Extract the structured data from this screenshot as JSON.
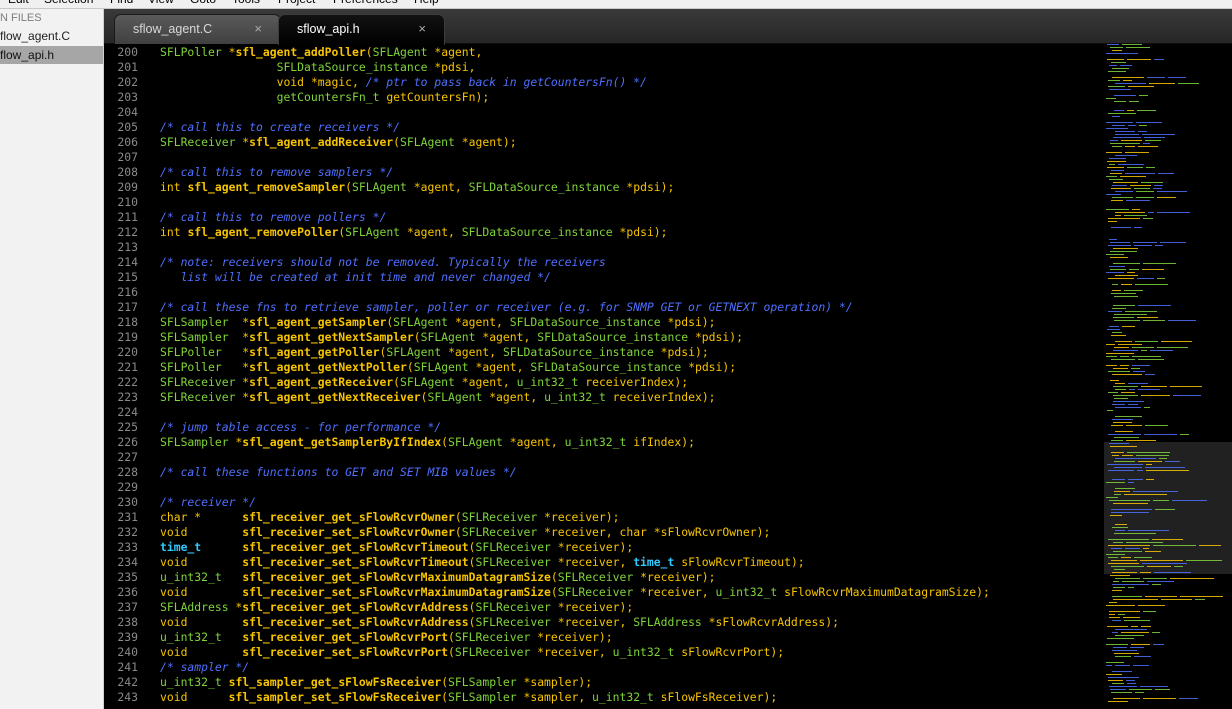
{
  "menu": {
    "items": [
      "Edit",
      "Selection",
      "Find",
      "View",
      "Goto",
      "Tools",
      "Project",
      "Preferences",
      "Help"
    ]
  },
  "sidebar": {
    "header": "N FILES",
    "files": [
      {
        "label": "flow_agent.C",
        "active": false
      },
      {
        "label": "flow_api.h",
        "active": true
      }
    ]
  },
  "tabs": [
    {
      "label": "sflow_agent.C",
      "active": false
    },
    {
      "label": "sflow_api.h",
      "active": true
    }
  ],
  "tab_close_glyph": "×",
  "colors": {
    "background": "#000000",
    "type": "#7fd43a",
    "function": "#f7c400",
    "text": "#f7c400",
    "comment": "#4f6fff",
    "builtin_type": "#33c9ff",
    "line_number": "#8a8a8a"
  },
  "editor": {
    "lines": [
      {
        "n": "200",
        "t": [
          [
            "ty",
            "SFLPoller"
          ],
          [
            "tx",
            " *"
          ],
          [
            "fn",
            "sfl_agent_addPoller"
          ],
          [
            "tx",
            "("
          ],
          [
            "ty",
            "SFLAgent"
          ],
          [
            "tx",
            " *agent,"
          ]
        ]
      },
      {
        "n": "201",
        "t": [
          [
            "tx",
            "                 "
          ],
          [
            "ty",
            "SFLDataSource_instance"
          ],
          [
            "tx",
            " *pdsi,"
          ]
        ]
      },
      {
        "n": "202",
        "t": [
          [
            "tx",
            "                 void *magic, "
          ],
          [
            "cm",
            "/* ptr to pass back in getCountersFn() */"
          ]
        ]
      },
      {
        "n": "203",
        "t": [
          [
            "tx",
            "                 "
          ],
          [
            "ty",
            "getCountersFn_t"
          ],
          [
            "tx",
            " getCountersFn);"
          ]
        ]
      },
      {
        "n": "204",
        "t": []
      },
      {
        "n": "205",
        "t": [
          [
            "cm",
            "/* call this to create receivers */"
          ]
        ]
      },
      {
        "n": "206",
        "t": [
          [
            "ty",
            "SFLReceiver"
          ],
          [
            "tx",
            " *"
          ],
          [
            "fn",
            "sfl_agent_addReceiver"
          ],
          [
            "tx",
            "("
          ],
          [
            "ty",
            "SFLAgent"
          ],
          [
            "tx",
            " *agent);"
          ]
        ]
      },
      {
        "n": "207",
        "t": []
      },
      {
        "n": "208",
        "t": [
          [
            "cm",
            "/* call this to remove samplers */"
          ]
        ]
      },
      {
        "n": "209",
        "t": [
          [
            "tx",
            "int "
          ],
          [
            "fn",
            "sfl_agent_removeSampler"
          ],
          [
            "tx",
            "("
          ],
          [
            "ty",
            "SFLAgent"
          ],
          [
            "tx",
            " *agent, "
          ],
          [
            "ty",
            "SFLDataSource_instance"
          ],
          [
            "tx",
            " *pdsi);"
          ]
        ]
      },
      {
        "n": "210",
        "t": []
      },
      {
        "n": "211",
        "t": [
          [
            "cm",
            "/* call this to remove pollers */"
          ]
        ]
      },
      {
        "n": "212",
        "t": [
          [
            "tx",
            "int "
          ],
          [
            "fn",
            "sfl_agent_removePoller"
          ],
          [
            "tx",
            "("
          ],
          [
            "ty",
            "SFLAgent"
          ],
          [
            "tx",
            " *agent, "
          ],
          [
            "ty",
            "SFLDataSource_instance"
          ],
          [
            "tx",
            " *pdsi);"
          ]
        ]
      },
      {
        "n": "213",
        "t": []
      },
      {
        "n": "214",
        "t": [
          [
            "cm",
            "/* note: receivers should not be removed. Typically the receivers"
          ]
        ]
      },
      {
        "n": "215",
        "t": [
          [
            "cm",
            "   list will be created at init time and never changed */"
          ]
        ]
      },
      {
        "n": "216",
        "t": []
      },
      {
        "n": "217",
        "t": [
          [
            "cm",
            "/* call these fns to retrieve sampler, poller or receiver (e.g. for SNMP GET or GETNEXT operation) */"
          ]
        ]
      },
      {
        "n": "218",
        "t": [
          [
            "ty",
            "SFLSampler"
          ],
          [
            "tx",
            "  *"
          ],
          [
            "fn",
            "sfl_agent_getSampler"
          ],
          [
            "tx",
            "("
          ],
          [
            "ty",
            "SFLAgent"
          ],
          [
            "tx",
            " *agent, "
          ],
          [
            "ty",
            "SFLDataSource_instance"
          ],
          [
            "tx",
            " *pdsi);"
          ]
        ]
      },
      {
        "n": "219",
        "t": [
          [
            "ty",
            "SFLSampler"
          ],
          [
            "tx",
            "  *"
          ],
          [
            "fn",
            "sfl_agent_getNextSampler"
          ],
          [
            "tx",
            "("
          ],
          [
            "ty",
            "SFLAgent"
          ],
          [
            "tx",
            " *agent, "
          ],
          [
            "ty",
            "SFLDataSource_instance"
          ],
          [
            "tx",
            " *pdsi);"
          ]
        ]
      },
      {
        "n": "220",
        "t": [
          [
            "ty",
            "SFLPoller"
          ],
          [
            "tx",
            "   *"
          ],
          [
            "fn",
            "sfl_agent_getPoller"
          ],
          [
            "tx",
            "("
          ],
          [
            "ty",
            "SFLAgent"
          ],
          [
            "tx",
            " *agent, "
          ],
          [
            "ty",
            "SFLDataSource_instance"
          ],
          [
            "tx",
            " *pdsi);"
          ]
        ]
      },
      {
        "n": "221",
        "t": [
          [
            "ty",
            "SFLPoller"
          ],
          [
            "tx",
            "   *"
          ],
          [
            "fn",
            "sfl_agent_getNextPoller"
          ],
          [
            "tx",
            "("
          ],
          [
            "ty",
            "SFLAgent"
          ],
          [
            "tx",
            " *agent, "
          ],
          [
            "ty",
            "SFLDataSource_instance"
          ],
          [
            "tx",
            " *pdsi);"
          ]
        ]
      },
      {
        "n": "222",
        "t": [
          [
            "ty",
            "SFLReceiver"
          ],
          [
            "tx",
            " *"
          ],
          [
            "fn",
            "sfl_agent_getReceiver"
          ],
          [
            "tx",
            "("
          ],
          [
            "ty",
            "SFLAgent"
          ],
          [
            "tx",
            " *agent, "
          ],
          [
            "ty",
            "u_int32_t"
          ],
          [
            "tx",
            " receiverIndex);"
          ]
        ]
      },
      {
        "n": "223",
        "t": [
          [
            "ty",
            "SFLReceiver"
          ],
          [
            "tx",
            " *"
          ],
          [
            "fn",
            "sfl_agent_getNextReceiver"
          ],
          [
            "tx",
            "("
          ],
          [
            "ty",
            "SFLAgent"
          ],
          [
            "tx",
            " *agent, "
          ],
          [
            "ty",
            "u_int32_t"
          ],
          [
            "tx",
            " receiverIndex);"
          ]
        ]
      },
      {
        "n": "224",
        "t": []
      },
      {
        "n": "225",
        "t": [
          [
            "cm",
            "/* jump table access - for performance */"
          ]
        ]
      },
      {
        "n": "226",
        "t": [
          [
            "ty",
            "SFLSampler"
          ],
          [
            "tx",
            " *"
          ],
          [
            "fn",
            "sfl_agent_getSamplerByIfIndex"
          ],
          [
            "tx",
            "("
          ],
          [
            "ty",
            "SFLAgent"
          ],
          [
            "tx",
            " *agent, "
          ],
          [
            "ty",
            "u_int32_t"
          ],
          [
            "tx",
            " ifIndex);"
          ]
        ]
      },
      {
        "n": "227",
        "t": []
      },
      {
        "n": "228",
        "t": [
          [
            "cm",
            "/* call these functions to GET and SET MIB values */"
          ]
        ]
      },
      {
        "n": "229",
        "t": []
      },
      {
        "n": "230",
        "t": [
          [
            "cm",
            "/* receiver */"
          ]
        ]
      },
      {
        "n": "231",
        "t": [
          [
            "tx",
            "char *      "
          ],
          [
            "fn",
            "sfl_receiver_get_sFlowRcvrOwner"
          ],
          [
            "tx",
            "("
          ],
          [
            "ty",
            "SFLReceiver"
          ],
          [
            "tx",
            " *receiver);"
          ]
        ]
      },
      {
        "n": "232",
        "t": [
          [
            "tx",
            "void        "
          ],
          [
            "fn",
            "sfl_receiver_set_sFlowRcvrOwner"
          ],
          [
            "tx",
            "("
          ],
          [
            "ty",
            "SFLReceiver"
          ],
          [
            "tx",
            " *receiver, char *sFlowRcvrOwner);"
          ]
        ]
      },
      {
        "n": "233",
        "t": [
          [
            "tb",
            "time_t"
          ],
          [
            "tx",
            "      "
          ],
          [
            "fn",
            "sfl_receiver_get_sFlowRcvrTimeout"
          ],
          [
            "tx",
            "("
          ],
          [
            "ty",
            "SFLReceiver"
          ],
          [
            "tx",
            " *receiver);"
          ]
        ]
      },
      {
        "n": "234",
        "t": [
          [
            "tx",
            "void        "
          ],
          [
            "fn",
            "sfl_receiver_set_sFlowRcvrTimeout"
          ],
          [
            "tx",
            "("
          ],
          [
            "ty",
            "SFLReceiver"
          ],
          [
            "tx",
            " *receiver, "
          ],
          [
            "tb",
            "time_t"
          ],
          [
            "tx",
            " sFlowRcvrTimeout);"
          ]
        ]
      },
      {
        "n": "235",
        "t": [
          [
            "ty",
            "u_int32_t"
          ],
          [
            "tx",
            "   "
          ],
          [
            "fn",
            "sfl_receiver_get_sFlowRcvrMaximumDatagramSize"
          ],
          [
            "tx",
            "("
          ],
          [
            "ty",
            "SFLReceiver"
          ],
          [
            "tx",
            " *receiver);"
          ]
        ]
      },
      {
        "n": "236",
        "t": [
          [
            "tx",
            "void        "
          ],
          [
            "fn",
            "sfl_receiver_set_sFlowRcvrMaximumDatagramSize"
          ],
          [
            "tx",
            "("
          ],
          [
            "ty",
            "SFLReceiver"
          ],
          [
            "tx",
            " *receiver, "
          ],
          [
            "ty",
            "u_int32_t"
          ],
          [
            "tx",
            " sFlowRcvrMaximumDatagramSize);"
          ]
        ]
      },
      {
        "n": "237",
        "t": [
          [
            "ty",
            "SFLAddress"
          ],
          [
            "tx",
            " *"
          ],
          [
            "fn",
            "sfl_receiver_get_sFlowRcvrAddress"
          ],
          [
            "tx",
            "("
          ],
          [
            "ty",
            "SFLReceiver"
          ],
          [
            "tx",
            " *receiver);"
          ]
        ]
      },
      {
        "n": "238",
        "t": [
          [
            "tx",
            "void        "
          ],
          [
            "fn",
            "sfl_receiver_set_sFlowRcvrAddress"
          ],
          [
            "tx",
            "("
          ],
          [
            "ty",
            "SFLReceiver"
          ],
          [
            "tx",
            " *receiver, "
          ],
          [
            "ty",
            "SFLAddress"
          ],
          [
            "tx",
            " *sFlowRcvrAddress);"
          ]
        ]
      },
      {
        "n": "239",
        "t": [
          [
            "ty",
            "u_int32_t"
          ],
          [
            "tx",
            "   "
          ],
          [
            "fn",
            "sfl_receiver_get_sFlowRcvrPort"
          ],
          [
            "tx",
            "("
          ],
          [
            "ty",
            "SFLReceiver"
          ],
          [
            "tx",
            " *receiver);"
          ]
        ]
      },
      {
        "n": "240",
        "t": [
          [
            "tx",
            "void        "
          ],
          [
            "fn",
            "sfl_receiver_set_sFlowRcvrPort"
          ],
          [
            "tx",
            "("
          ],
          [
            "ty",
            "SFLReceiver"
          ],
          [
            "tx",
            " *receiver, "
          ],
          [
            "ty",
            "u_int32_t"
          ],
          [
            "tx",
            " sFlowRcvrPort);"
          ]
        ]
      },
      {
        "n": "241",
        "t": [
          [
            "cm",
            "/* sampler */"
          ]
        ]
      },
      {
        "n": "242",
        "t": [
          [
            "ty",
            "u_int32_t"
          ],
          [
            "tx",
            " "
          ],
          [
            "fn",
            "sfl_sampler_get_sFlowFsReceiver"
          ],
          [
            "tx",
            "("
          ],
          [
            "ty",
            "SFLSampler"
          ],
          [
            "tx",
            " *sampler);"
          ]
        ]
      },
      {
        "n": "243",
        "t": [
          [
            "tx",
            "void      "
          ],
          [
            "fn",
            "sfl_sampler_set_sFlowFsReceiver"
          ],
          [
            "tx",
            "("
          ],
          [
            "ty",
            "SFLSampler"
          ],
          [
            "tx",
            " *sampler, "
          ],
          [
            "ty",
            "u_int32_t"
          ],
          [
            "tx",
            " sFlowFsReceiver);"
          ]
        ]
      }
    ]
  }
}
